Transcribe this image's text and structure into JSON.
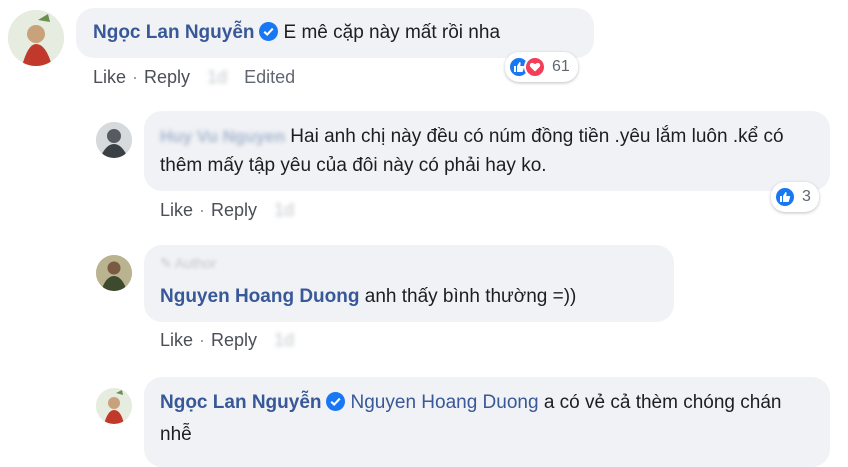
{
  "comments": [
    {
      "author": "Ngọc Lan Nguyễn",
      "text": "E mê cặp này mất rồi nha",
      "actions": {
        "like": "Like",
        "reply": "Reply",
        "time": "1d",
        "edited": "Edited"
      },
      "reaction_count": "61"
    },
    {
      "author": "Huy Vu Nguyen",
      "text": "Hai anh chị này đều có núm đồng tiền .yêu lắm luôn .kể có thêm mấy tập yêu của đôi này có phải hay ko.",
      "actions": {
        "like": "Like",
        "reply": "Reply",
        "time": "1d"
      },
      "reaction_count": "3"
    },
    {
      "badge": "Author",
      "author": "Nguyen Hoang Duong",
      "text": "anh thấy bình thường =))",
      "actions": {
        "like": "Like",
        "reply": "Reply",
        "time": "1d"
      }
    },
    {
      "author": "Ngọc Lan Nguyễn",
      "mention": "Nguyen Hoang Duong",
      "text": "a có vẻ cả thèm chóng chán nhễ"
    }
  ],
  "colors": {
    "name": "#385898",
    "bubble": "#f0f2f5",
    "like": "#1877f2",
    "love": "#f33e58"
  }
}
